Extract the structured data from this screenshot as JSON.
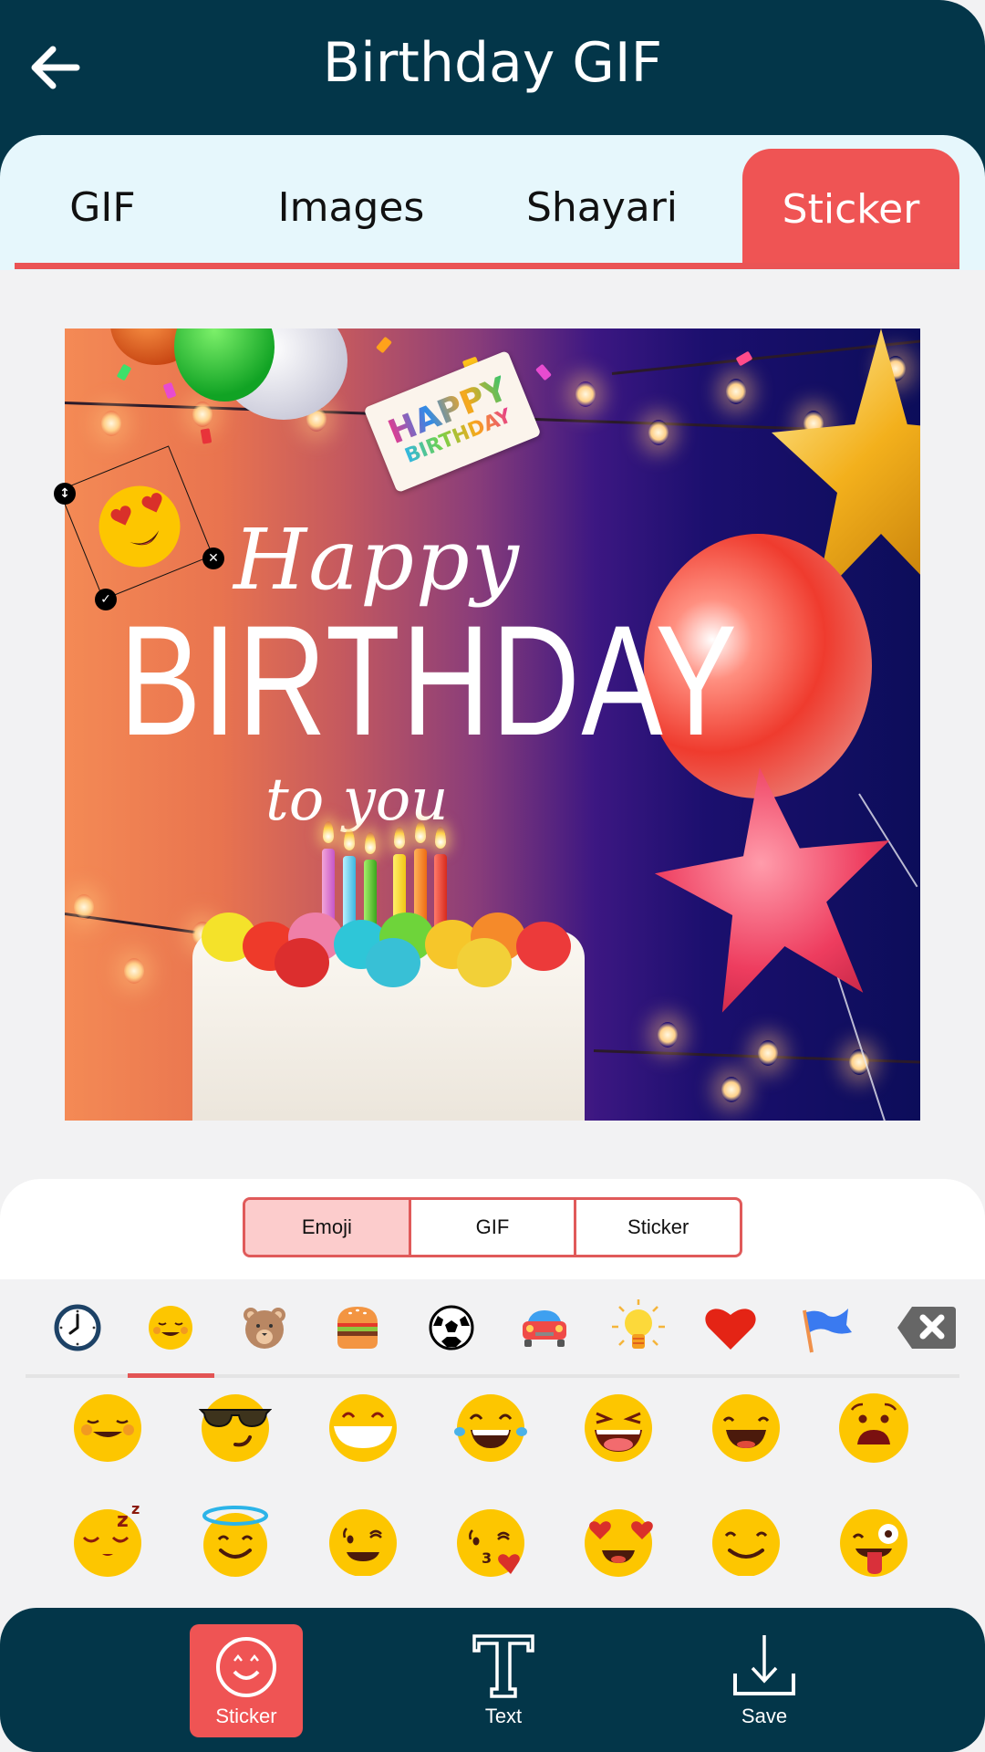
{
  "header": {
    "title": "Birthday GIF",
    "back_icon": "arrow-left-icon"
  },
  "tabs": [
    {
      "label": "GIF",
      "active": false
    },
    {
      "label": "Images",
      "active": false
    },
    {
      "label": "Shayari",
      "active": false
    },
    {
      "label": "Sticker",
      "active": true
    }
  ],
  "canvas": {
    "image_description": "Happy Birthday card with cake, candles, balloons and string lights",
    "tag_line1": "HAPPY",
    "tag_line2": "BIRTHDAY",
    "script_top": "Happy",
    "headline": "BIRTHDAY",
    "script_bottom": "to you",
    "sticker": {
      "emoji": "smiling-face-with-heart-eyes",
      "handles": {
        "resize": "↕",
        "delete": "✕",
        "confirm": "✓"
      }
    }
  },
  "sticker_panel": {
    "segments": [
      {
        "label": "Emoji",
        "active": true
      },
      {
        "label": "GIF",
        "active": false
      },
      {
        "label": "Sticker",
        "active": false
      }
    ],
    "categories": [
      {
        "name": "recent",
        "icon": "clock-icon",
        "active": false
      },
      {
        "name": "smileys",
        "icon": "smiley-icon",
        "active": true
      },
      {
        "name": "animals",
        "icon": "bear-icon",
        "active": false
      },
      {
        "name": "food",
        "icon": "burger-icon",
        "active": false
      },
      {
        "name": "activities",
        "icon": "soccer-ball-icon",
        "active": false
      },
      {
        "name": "travel",
        "icon": "car-icon",
        "active": false
      },
      {
        "name": "objects",
        "icon": "lightbulb-icon",
        "active": false
      },
      {
        "name": "symbols",
        "icon": "heart-icon",
        "active": false
      },
      {
        "name": "flags",
        "icon": "flag-icon",
        "active": false
      },
      {
        "name": "delete",
        "icon": "backspace-icon",
        "active": false
      }
    ],
    "emojis": [
      "smiling-blush",
      "sunglasses",
      "grinning-teeth",
      "tears-of-joy",
      "squinting-laugh",
      "grinning-smile",
      "anguished",
      "sleeping",
      "halo",
      "winking",
      "kissing-heart",
      "heart-eyes",
      "smiling-eyes",
      "winking-tongue"
    ]
  },
  "bottom_nav": [
    {
      "label": "Sticker",
      "icon": "smiley-outline-icon",
      "active": true
    },
    {
      "label": "Text",
      "icon": "text-t-icon",
      "active": false
    },
    {
      "label": "Save",
      "icon": "download-icon",
      "active": false
    }
  ],
  "colors": {
    "primary_dark": "#033649",
    "accent": "#ef5454",
    "tab_bg": "#e6f7fc",
    "segment_active_bg": "#fccccc",
    "emoji_yellow": "#ffcc00"
  }
}
